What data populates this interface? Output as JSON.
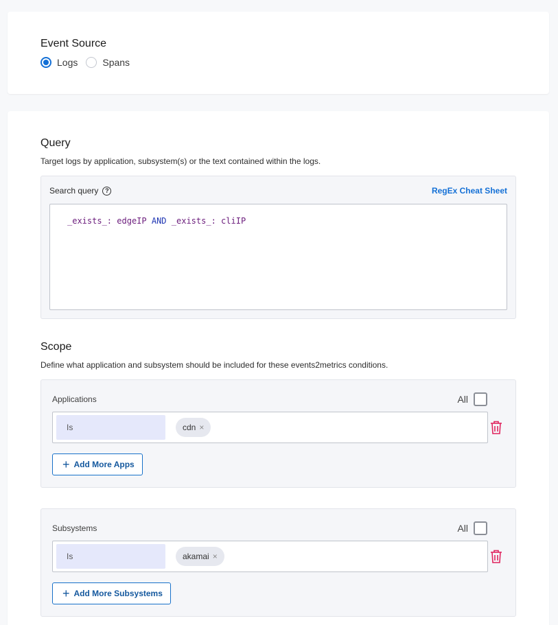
{
  "event_source": {
    "title": "Event Source",
    "options": [
      {
        "label": "Logs",
        "selected": true
      },
      {
        "label": "Spans",
        "selected": false
      }
    ]
  },
  "query": {
    "title": "Query",
    "description": "Target logs by application, subsystem(s) or the text contained within the logs.",
    "search_label": "Search query",
    "help_icon": "?",
    "regex_link": "RegEx Cheat Sheet",
    "tokens": {
      "t1": "_exists_:",
      "t2": "edgeIP",
      "t3": "AND",
      "t4": "_exists_:",
      "t5": "cliIP"
    }
  },
  "scope": {
    "title": "Scope",
    "description": "Define what application and subsystem should be included for these events2metrics conditions.",
    "applications": {
      "label": "Applications",
      "all_label": "All",
      "all_checked": false,
      "operator": "Is",
      "chip": "cdn",
      "add_button": "Add More Apps"
    },
    "subsystems": {
      "label": "Subsystems",
      "all_label": "All",
      "all_checked": false,
      "operator": "Is",
      "chip": "akamai",
      "add_button": "Add More Subsystems"
    }
  },
  "icons": {
    "chip_remove": "×",
    "plus": "+",
    "trash": "trash-icon"
  },
  "colors": {
    "accent": "#1470d6",
    "danger": "#e0245e",
    "operator_bg": "#e5e8fb"
  }
}
